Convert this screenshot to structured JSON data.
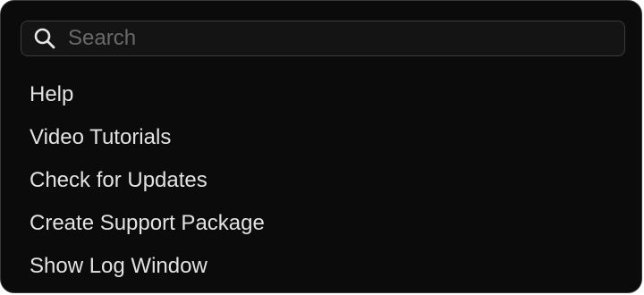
{
  "search": {
    "placeholder": "Search",
    "value": "",
    "icon": "search-icon"
  },
  "menu": {
    "items": [
      {
        "label": "Help"
      },
      {
        "label": "Video Tutorials"
      },
      {
        "label": "Check for Updates"
      },
      {
        "label": "Create Support Package"
      },
      {
        "label": "Show Log Window"
      }
    ]
  },
  "colors": {
    "background": "#0b0b0b",
    "text": "#e2e2e2",
    "placeholder": "#6a6a6a",
    "border": "#3a3a3a"
  }
}
